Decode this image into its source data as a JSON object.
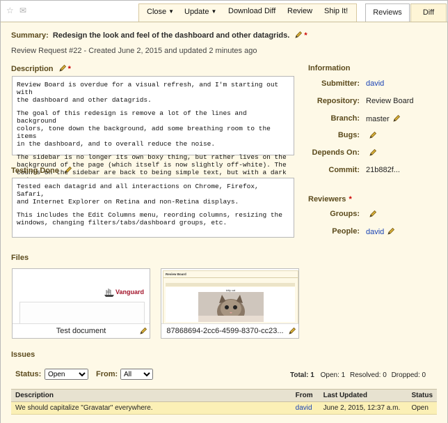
{
  "topbar": {
    "star_icon": "star-icon",
    "mail_icon": "mail-icon",
    "actions": {
      "close": "Close",
      "update": "Update",
      "download_diff": "Download Diff",
      "review": "Review",
      "ship_it": "Ship It!"
    },
    "tabs": {
      "reviews": "Reviews",
      "diff": "Diff"
    }
  },
  "summary": {
    "label": "Summary:",
    "text": "Redesign the look and feel of the dashboard and other datagrids."
  },
  "request_line": "Review Request #22 - Created June 2, 2015 and updated 2 minutes ago",
  "description": {
    "label": "Description",
    "paragraphs": [
      "Review Board is overdue for a visual refresh, and I'm starting out with\nthe dashboard and other datagrids.",
      "The goal of this redesign is remove a lot of the lines and background\ncolors, tone down the background, add some breathing room to the items\nin the dashboard, and to overall reduce the noise.",
      "The sidebar is no longer its own boxy thing, but rather lives on the\nbackground of the page (which itself is now slightly off-white). The\ncounts on the sidebar are back to being simple text, but with a dark red\ninstead of black/grey, keeping things simple but clear."
    ]
  },
  "testing": {
    "label": "Testing Done",
    "paragraphs": [
      "Tested each datagrid and all interactions on Chrome, Firefox, Safari,\nand Internet Explorer on Retina and non-Retina displays.",
      "This includes the Edit Columns menu, reording columns, resizing the\nwindows, changing filters/tabs/dashboard groups, etc."
    ]
  },
  "information": {
    "title": "Information",
    "submitter_label": "Submitter:",
    "submitter": "david",
    "repository_label": "Repository:",
    "repository": "Review Board",
    "branch_label": "Branch:",
    "branch": "master",
    "bugs_label": "Bugs:",
    "depends_label": "Depends On:",
    "commit_label": "Commit:",
    "commit": "21b882f..."
  },
  "reviewers": {
    "title": "Reviewers",
    "groups_label": "Groups:",
    "people_label": "People:",
    "people": "david"
  },
  "files": {
    "title": "Files",
    "items": [
      {
        "caption": "Test document",
        "brand": "Vanguard"
      },
      {
        "caption": "87868694-2cc6-4599-8370-cc23...",
        "mini_title": "Review Board",
        "mini_caption": "kitty cat"
      }
    ]
  },
  "issues": {
    "title": "Issues",
    "status_label": "Status:",
    "status_value": "Open",
    "from_label": "From:",
    "from_value": "All",
    "total_label": "Total:",
    "total": "1",
    "open_label": "Open:",
    "open": "1",
    "resolved_label": "Resolved:",
    "resolved": "0",
    "dropped_label": "Dropped:",
    "dropped": "0",
    "columns": [
      "Description",
      "From",
      "Last Updated",
      "Status"
    ],
    "rows": [
      {
        "description": "We should capitalize \"Gravatar\" everywhere.",
        "from": "david",
        "updated": "June 2, 2015, 12:37 a.m.",
        "status": "Open"
      }
    ]
  },
  "colors": {
    "background": "#fef9e7",
    "heading": "#5b4a1c",
    "link": "#1a43b5",
    "required": "#cc0000",
    "issue_row": "#fbf0b6"
  }
}
